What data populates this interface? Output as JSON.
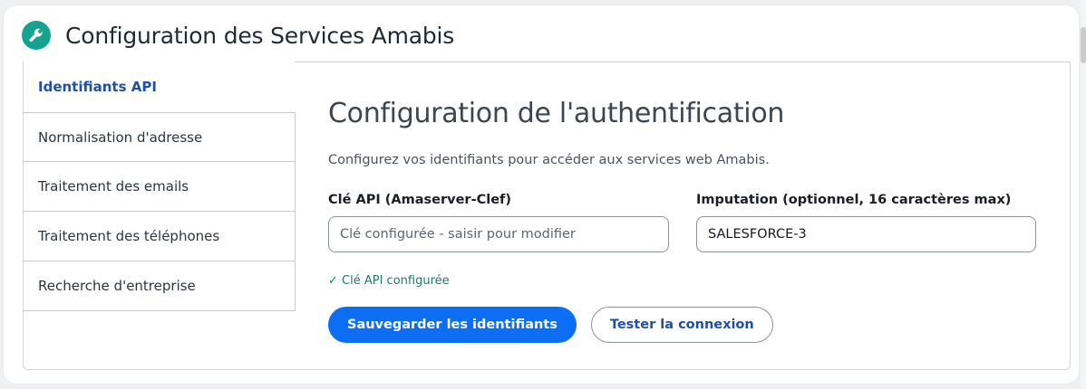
{
  "header": {
    "title": "Configuration des Services Amabis",
    "icon": "wrench-icon",
    "icon_color": "#15a38f"
  },
  "sidebar": {
    "items": [
      {
        "label": "Identifiants API",
        "active": true
      },
      {
        "label": "Normalisation d'adresse",
        "active": false
      },
      {
        "label": "Traitement des emails",
        "active": false
      },
      {
        "label": "Traitement des téléphones",
        "active": false
      },
      {
        "label": "Recherche d'entreprise",
        "active": false
      }
    ]
  },
  "main": {
    "title": "Configuration de l'authentification",
    "description": "Configurez vos identifiants pour accéder aux services web Amabis.",
    "api_key": {
      "label": "Clé API (Amaserver-Clef)",
      "placeholder": "Clé configurée - saisir pour modifier",
      "value": "",
      "status": "✓ Clé API configurée"
    },
    "imputation": {
      "label": "Imputation (optionnel, 16 caractères max)",
      "placeholder": "",
      "value": "SALESFORCE-3"
    },
    "buttons": {
      "save": "Sauvegarder les identifiants",
      "test": "Tester la connexion"
    }
  },
  "colors": {
    "primary": "#0b6ef5",
    "active_nav": "#1f4fa8",
    "success": "#1f7a6a"
  }
}
